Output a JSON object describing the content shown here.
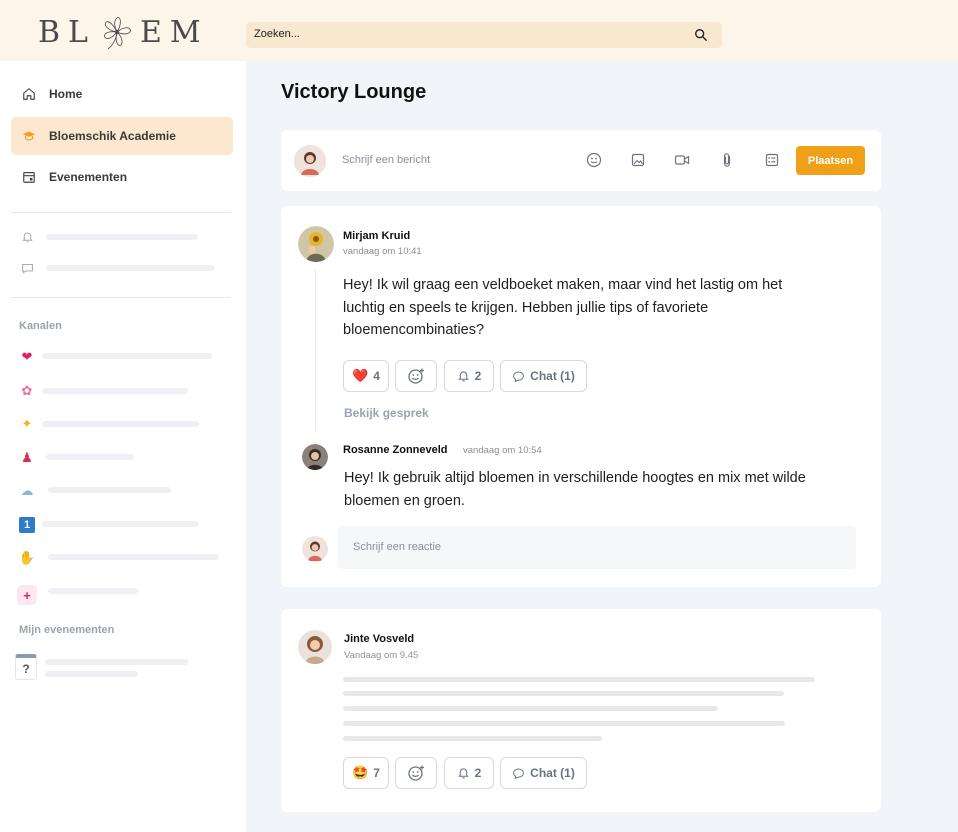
{
  "header": {
    "logo_left": "BL",
    "logo_right": "EM",
    "search_placeholder": "Zoeken..."
  },
  "sidebar": {
    "nav": [
      {
        "label": "Home",
        "icon": "home-icon"
      },
      {
        "label": "Bloemschik Academie",
        "icon": "graduation-cap-icon",
        "active": true
      },
      {
        "label": "Evenementen",
        "icon": "calendar-icon"
      }
    ],
    "channels_label": "Kanalen",
    "channel_icons": [
      "❤",
      "✿",
      "✦",
      "♟",
      "☁",
      "1",
      "✋",
      "+"
    ],
    "events_label": "Mijn evenementen",
    "event_icon": "?"
  },
  "main": {
    "title": "Victory Lounge",
    "composer": {
      "placeholder": "Schrijf een bericht",
      "post_label": "Plaatsen"
    },
    "posts": [
      {
        "author": "Mirjam Kruid",
        "timestamp": "vandaag om 10:41",
        "text": "Hey! Ik wil graag een veldboeket maken, maar vind het lastig om het luchtig en speels te krijgen. Hebben jullie tips of favoriete bloemencombinaties?",
        "reactions": {
          "emoji": "❤️",
          "count": "4"
        },
        "notify_count": "2",
        "chat_label": "Chat (1)",
        "view_thread": "Bekijk gesprek",
        "reply": {
          "author": "Rosanne Zonneveld",
          "timestamp": "vandaag om 10:54",
          "text": "Hey! Ik gebruik altijd bloemen in verschillende hoogtes en mix met wilde bloemen en groen."
        },
        "reply_placeholder": "Schrijf een reactie"
      },
      {
        "author": "Jinte Vosveld",
        "timestamp": "Vandaag om 9.45",
        "reactions": {
          "emoji": "🤩",
          "count": "7"
        },
        "notify_count": "2",
        "chat_label": "Chat (1)"
      }
    ]
  },
  "colors": {
    "accent": "#f0a018",
    "header_bg": "#fcf5ea",
    "active_nav": "#fbe8cf",
    "main_bg": "#f1f4f8"
  }
}
